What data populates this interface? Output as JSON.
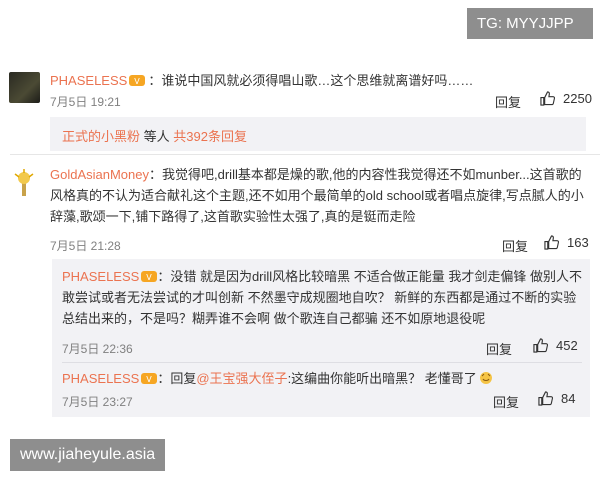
{
  "watermarks": {
    "top": "TG: MYYJJPP",
    "bottom": "www.jiaheyule.asia"
  },
  "comment1": {
    "user": "PHASELESS",
    "text": "谁说中国风就必须得唱山歌…这个思维就离谱好吗……",
    "time": "7月5日 19:21",
    "reply": "回复",
    "likes": "2250"
  },
  "more_replies": {
    "user": "正式的小黑粉",
    "mid": " 等人 ",
    "count": "共392条回复"
  },
  "comment2": {
    "user": "GoldAsianMoney",
    "text": "我觉得吧,drill基本都是燥的歌,他的内容性我觉得还不如munber...这首歌的风格真的不认为适合献礼这个主题,还不如用个最简单的old school或者唱点旋律,写点腻人的小辞藻,歌颂一下,铺下路得了,这首歌实验性太强了,真的是铤而走险",
    "time": "7月5日 21:28",
    "reply": "回复",
    "likes": "163"
  },
  "reply1": {
    "user": "PHASELESS",
    "text": "没错 就是因为drill风格比较暗黑 不适合做正能量 我才剑走偏锋  做别人不敢尝试或者无法尝试的才叫创新 不然墨守成规圈地自吹？ 新鲜的东西都是通过不断的实验总结出来的，不是吗？糊弄谁不会啊 做个歌连自己都骗 还不如原地退役呢",
    "time": "7月5日 22:36",
    "reply": "回复",
    "likes": "452"
  },
  "reply2": {
    "user": "PHASELESS",
    "prefix": "回复",
    "mention": "@王宝强大侄子",
    "text": ":这编曲你能听出暗黑？ 老懂哥了",
    "time": "7月5日 23:27",
    "reply": "回复",
    "likes": "84"
  },
  "icons": {
    "like": "thumbs-up-icon",
    "badge": "vip-badge-icon",
    "emoji": "clap-hands-emoji"
  },
  "colors": {
    "username": "#eb7350",
    "panel": "#f2f2f5",
    "watermark": "#8e8e8e"
  }
}
